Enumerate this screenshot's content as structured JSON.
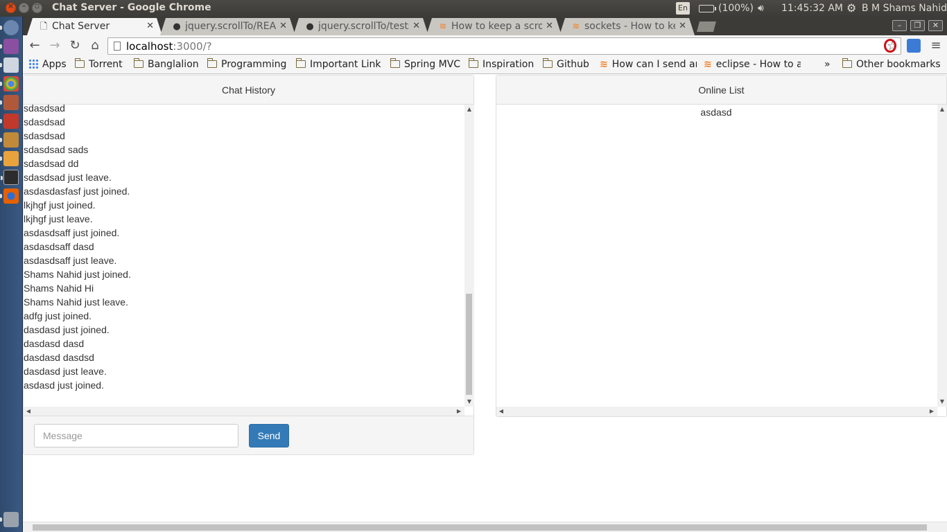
{
  "window": {
    "title": "Chat Server - Google Chrome"
  },
  "system_tray": {
    "language": "En",
    "battery": "(100%)",
    "clock": "11:45:32 AM",
    "user": "B M Shams Nahid"
  },
  "tabs": [
    {
      "label": "Chat Server",
      "icon": "page-icon",
      "active": true
    },
    {
      "label": "jquery.scrollTo/README",
      "icon": "github-icon",
      "active": false
    },
    {
      "label": "jquery.scrollTo/tests",
      "icon": "github-icon",
      "active": false
    },
    {
      "label": "How to keep a scroll",
      "icon": "stackoverflow-icon",
      "active": false
    },
    {
      "label": "sockets - How to keep",
      "icon": "stackoverflow-icon",
      "active": false
    }
  ],
  "address_bar": {
    "host": "localhost",
    "path": ":3000/?"
  },
  "bookmarks": [
    {
      "label": "Apps",
      "icon": "apps-grid-icon"
    },
    {
      "label": "Torrent",
      "icon": "folder-icon"
    },
    {
      "label": "Banglalion",
      "icon": "folder-icon"
    },
    {
      "label": "Programming",
      "icon": "folder-icon"
    },
    {
      "label": "Important Link",
      "icon": "folder-icon"
    },
    {
      "label": "Spring MVC",
      "icon": "folder-icon"
    },
    {
      "label": "Inspiration",
      "icon": "folder-icon"
    },
    {
      "label": "Github",
      "icon": "folder-icon"
    },
    {
      "label": "How can I send an",
      "icon": "stackoverflow-icon"
    },
    {
      "label": "eclipse - How to a",
      "icon": "stackoverflow-icon"
    }
  ],
  "bookmarks_overflow": "»",
  "other_bookmarks": "Other bookmarks",
  "chat": {
    "heading": "Chat History",
    "messages": [
      "sdasdsad",
      "sdasdsad",
      "sdasdsad",
      "sdasdsad sads",
      "sdasdsad dd",
      "sdasdsad just leave.",
      "asdasdasfasf just joined.",
      "lkjhgf just joined.",
      "lkjhgf just leave.",
      "asdasdsaff just joined.",
      "asdasdsaff dasd",
      "asdasdsaff just leave.",
      "Shams Nahid just joined.",
      "Shams Nahid Hi",
      "Shams Nahid just leave.",
      "adfg just joined.",
      "dasdasd just joined.",
      "dasdasd dasd",
      "dasdasd dasdsd",
      "dasdasd just leave.",
      "asdasd just joined."
    ],
    "input_placeholder": "Message",
    "input_value": "",
    "send_label": "Send"
  },
  "online": {
    "heading": "Online List",
    "users": [
      "asdasd"
    ]
  },
  "colors": {
    "send_button": "#337ab7",
    "panel_heading_bg": "#f5f5f5",
    "launcher_bg": "#3a5983",
    "close_button": "#df4a16"
  }
}
